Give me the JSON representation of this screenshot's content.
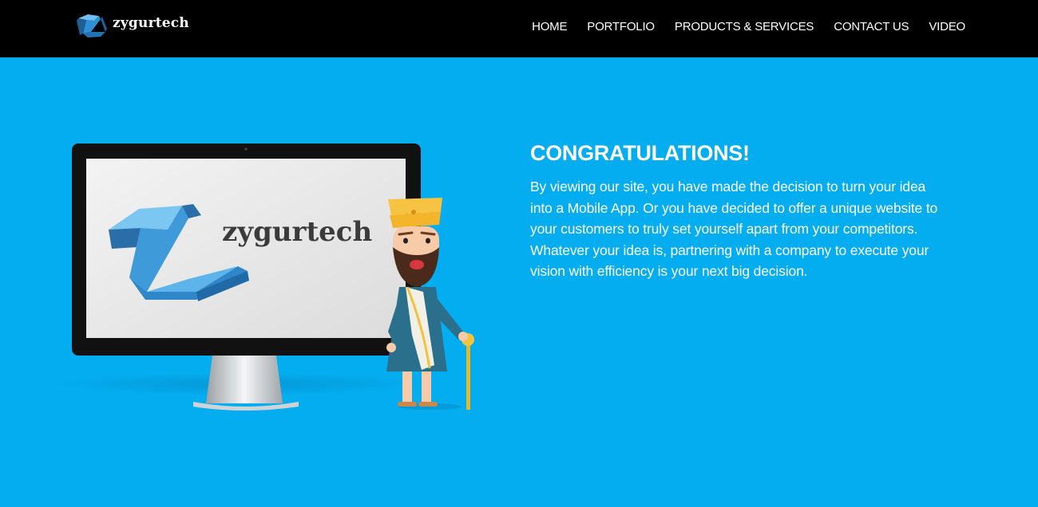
{
  "brand": {
    "name": "zygurtech"
  },
  "nav": {
    "items": [
      {
        "label": "HOME"
      },
      {
        "label": "PORTFOLIO"
      },
      {
        "label": "PRODUCTS & SERVICES"
      },
      {
        "label": "CONTACT US"
      },
      {
        "label": "VIDEO"
      }
    ]
  },
  "hero": {
    "monitor_logo_text": "zygurtech",
    "title": "CONGRATULATIONS!",
    "body": "By viewing our site, you have made the decision to turn your idea into a Mobile App. Or you have decided to offer a unique website to your customers to truly set yourself apart from your competitors. Whatever your idea is, partnering with a company to execute your vision with efficiency is your next big decision."
  },
  "colors": {
    "background": "#04adef",
    "navbar": "#000000",
    "text": "#ffffff",
    "logo_blue": "#2f8fd4"
  }
}
